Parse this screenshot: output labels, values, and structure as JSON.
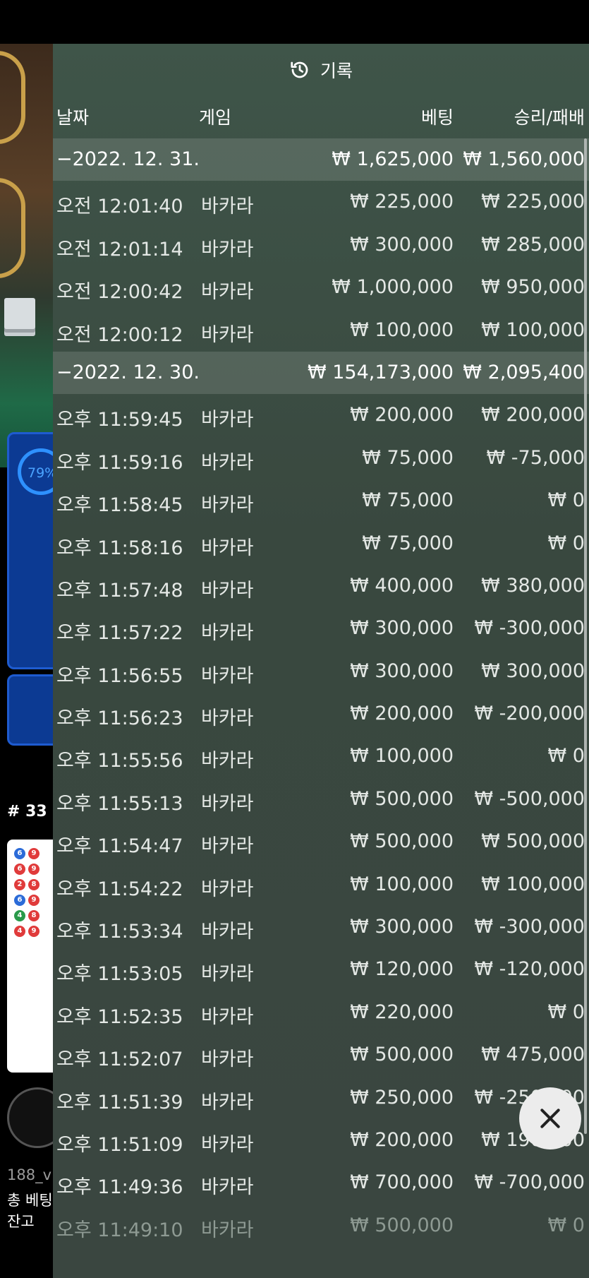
{
  "background": {
    "percent": "79%",
    "round_label": "# 33",
    "username_line": "188_v",
    "bet_label": "총 베팅",
    "balance_label": "잔고"
  },
  "history": {
    "title": "기록",
    "columns": {
      "date": "날짜",
      "game": "게임",
      "bet": "베팅",
      "winloss": "승리/패배"
    },
    "rows": [
      {
        "type": "date",
        "time": "−2022. 12. 31.",
        "game": "",
        "bet": "₩ 1,625,000",
        "winloss": "₩ 1,560,000"
      },
      {
        "type": "item",
        "time": "오전 12:01:40",
        "game": "바카라",
        "bet": "₩ 225,000",
        "winloss": "₩ 225,000"
      },
      {
        "type": "item",
        "time": "오전 12:01:14",
        "game": "바카라",
        "bet": "₩ 300,000",
        "winloss": "₩ 285,000"
      },
      {
        "type": "item",
        "time": "오전 12:00:42",
        "game": "바카라",
        "bet": "₩ 1,000,000",
        "winloss": "₩ 950,000"
      },
      {
        "type": "item",
        "time": "오전 12:00:12",
        "game": "바카라",
        "bet": "₩ 100,000",
        "winloss": "₩ 100,000"
      },
      {
        "type": "date",
        "time": "−2022. 12. 30.",
        "game": "",
        "bet": "₩ 154,173,000",
        "winloss": "₩ 2,095,400"
      },
      {
        "type": "item",
        "time": "오후 11:59:45",
        "game": "바카라",
        "bet": "₩ 200,000",
        "winloss": "₩ 200,000"
      },
      {
        "type": "item",
        "time": "오후 11:59:16",
        "game": "바카라",
        "bet": "₩ 75,000",
        "winloss": "₩ -75,000"
      },
      {
        "type": "item",
        "time": "오후 11:58:45",
        "game": "바카라",
        "bet": "₩ 75,000",
        "winloss": "₩ 0"
      },
      {
        "type": "item",
        "time": "오후 11:58:16",
        "game": "바카라",
        "bet": "₩ 75,000",
        "winloss": "₩ 0"
      },
      {
        "type": "item",
        "time": "오후 11:57:48",
        "game": "바카라",
        "bet": "₩ 400,000",
        "winloss": "₩ 380,000"
      },
      {
        "type": "item",
        "time": "오후 11:57:22",
        "game": "바카라",
        "bet": "₩ 300,000",
        "winloss": "₩ -300,000"
      },
      {
        "type": "item",
        "time": "오후 11:56:55",
        "game": "바카라",
        "bet": "₩ 300,000",
        "winloss": "₩ 300,000"
      },
      {
        "type": "item",
        "time": "오후 11:56:23",
        "game": "바카라",
        "bet": "₩ 200,000",
        "winloss": "₩ -200,000"
      },
      {
        "type": "item",
        "time": "오후 11:55:56",
        "game": "바카라",
        "bet": "₩ 100,000",
        "winloss": "₩ 0"
      },
      {
        "type": "item",
        "time": "오후 11:55:13",
        "game": "바카라",
        "bet": "₩ 500,000",
        "winloss": "₩ -500,000"
      },
      {
        "type": "item",
        "time": "오후 11:54:47",
        "game": "바카라",
        "bet": "₩ 500,000",
        "winloss": "₩ 500,000"
      },
      {
        "type": "item",
        "time": "오후 11:54:22",
        "game": "바카라",
        "bet": "₩ 100,000",
        "winloss": "₩ 100,000"
      },
      {
        "type": "item",
        "time": "오후 11:53:34",
        "game": "바카라",
        "bet": "₩ 300,000",
        "winloss": "₩ -300,000"
      },
      {
        "type": "item",
        "time": "오후 11:53:05",
        "game": "바카라",
        "bet": "₩ 120,000",
        "winloss": "₩ -120,000"
      },
      {
        "type": "item",
        "time": "오후 11:52:35",
        "game": "바카라",
        "bet": "₩ 220,000",
        "winloss": "₩ 0"
      },
      {
        "type": "item",
        "time": "오후 11:52:07",
        "game": "바카라",
        "bet": "₩ 500,000",
        "winloss": "₩ 475,000"
      },
      {
        "type": "item",
        "time": "오후 11:51:39",
        "game": "바카라",
        "bet": "₩ 250,000",
        "winloss": "₩ -250,000"
      },
      {
        "type": "item",
        "time": "오후 11:51:09",
        "game": "바카라",
        "bet": "₩ 200,000",
        "winloss": "₩ 190,000"
      },
      {
        "type": "item",
        "time": "오후 11:49:36",
        "game": "바카라",
        "bet": "₩ 700,000",
        "winloss": "₩ -700,000"
      },
      {
        "type": "item",
        "time": "오후 11:49:10",
        "game": "바카라",
        "bet": "₩ 500,000",
        "winloss": "₩ 0",
        "faded": true
      }
    ]
  },
  "icons": {
    "history": "history-icon",
    "close": "close-icon"
  },
  "colors": {
    "panel": "#3f5549",
    "date_row_tint": "rgba(255,255,255,0.13)",
    "accent_blue": "#2e91ff"
  }
}
